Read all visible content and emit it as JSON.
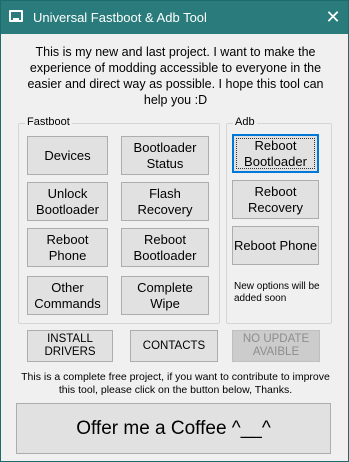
{
  "window": {
    "title": "Universal Fastboot & Adb Tool",
    "close_glyph": "✕",
    "icon": "terminal-icon"
  },
  "intro": "This is my new and last project. I want to make the experience of modding accessible to everyone in the easier and direct way as possible. I hope this tool can help you :D",
  "fastboot": {
    "label": "Fastboot",
    "buttons": [
      "Devices",
      "Bootloader Status",
      "Unlock Bootloader",
      "Flash Recovery",
      "Reboot Phone",
      "Reboot Bootloader",
      "Other Commands",
      "Complete Wipe"
    ]
  },
  "adb": {
    "label": "Adb",
    "buttons": [
      "Reboot Bootloader",
      "Reboot Recovery",
      "Reboot Phone"
    ],
    "note": "New options will be added soon"
  },
  "bottom_buttons": {
    "install_drivers": "INSTALL DRIVERS",
    "contacts": "CONTACTS",
    "no_update": "NO UPDATE AVAIBLE"
  },
  "footer_text": "This is a complete free project, if you want to contribute to improve this tool, please click on the button below, Thanks.",
  "coffee_button": "Offer me a Coffee ^__^",
  "colors": {
    "titlebar": "#2a7b7b",
    "focus_border": "#0078d7",
    "button_bg": "#e1e1e1",
    "window_bg": "#f0f0f0"
  }
}
